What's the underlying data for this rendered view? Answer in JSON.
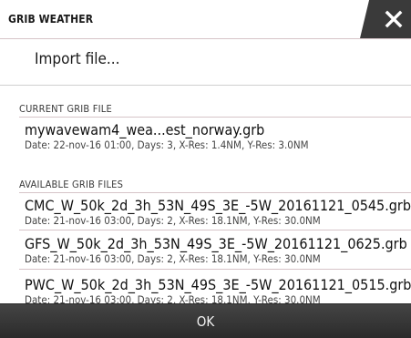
{
  "dialog": {
    "title": "GRIB WEATHER",
    "close_icon": "close-icon"
  },
  "import": {
    "label": "Import file..."
  },
  "current": {
    "header": "CURRENT GRIB FILE",
    "name": "mywavewam4_wea...est_norway.grb",
    "meta": "Date: 22-nov-16 01:00, Days: 3, X-Res: 1.4NM, Y-Res: 3.0NM"
  },
  "available": {
    "header": "AVAILABLE GRIB FILES",
    "files": [
      {
        "name": "CMC_W_50k_2d_3h_53N_49S_3E_-5W_20161121_0545.grb",
        "meta": "Date: 21-nov-16 03:00, Days: 2, X-Res: 18.1NM, Y-Res: 30.0NM"
      },
      {
        "name": "GFS_W_50k_2d_3h_53N_49S_3E_-5W_20161121_0625.grb",
        "meta": "Date: 21-nov-16 03:00, Days: 2, X-Res: 18.1NM, Y-Res: 30.0NM"
      },
      {
        "name": "PWC_W_50k_2d_3h_53N_49S_3E_-5W_20161121_0515.grb",
        "meta": "Date: 21-nov-16 03:00, Days: 2, X-Res: 18.1NM, Y-Res: 30.0NM"
      }
    ]
  },
  "footer": {
    "ok_label": "OK"
  },
  "colors": {
    "separator": "#d6c4c8",
    "footer": "#3a3a3a",
    "close_bg": "#3a3a3a"
  }
}
